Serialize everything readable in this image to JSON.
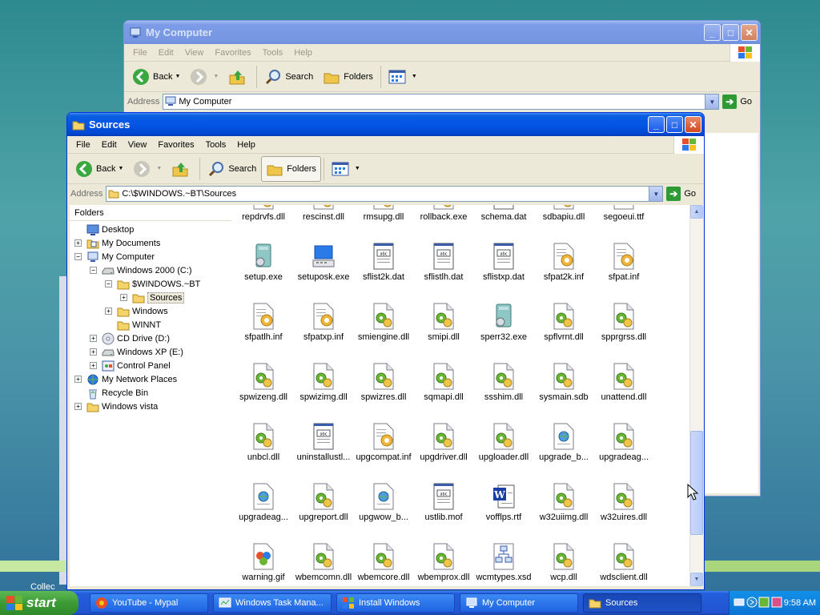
{
  "my_computer_window": {
    "title": "My Computer",
    "menu": [
      "File",
      "Edit",
      "View",
      "Favorites",
      "Tools",
      "Help"
    ],
    "toolbar": {
      "back": "Back",
      "search": "Search",
      "folders": "Folders"
    },
    "address_label": "Address",
    "address_value": "My Computer",
    "go_label": "Go"
  },
  "sources_window": {
    "title": "Sources",
    "menu": [
      "File",
      "Edit",
      "View",
      "Favorites",
      "Tools",
      "Help"
    ],
    "toolbar": {
      "back": "Back",
      "search": "Search",
      "folders": "Folders"
    },
    "address_label": "Address",
    "address_value": "C:\\$WINDOWS.~BT\\Sources",
    "go_label": "Go",
    "folders_pane_title": "Folders",
    "tree": [
      {
        "label": "Desktop",
        "expander": "none"
      },
      {
        "label": "My Documents",
        "expander": "+"
      },
      {
        "label": "My Computer",
        "expander": "-"
      },
      {
        "label": "Windows 2000 (C:)",
        "expander": "-"
      },
      {
        "label": "$WINDOWS.~BT",
        "expander": "-"
      },
      {
        "label": "Sources",
        "expander": "+",
        "selected": true
      },
      {
        "label": "Windows",
        "expander": "+"
      },
      {
        "label": "WINNT",
        "expander": "none"
      },
      {
        "label": "CD Drive (D:)",
        "expander": "+"
      },
      {
        "label": "Windows XP (E:)",
        "expander": "+"
      },
      {
        "label": "Control Panel",
        "expander": "+"
      },
      {
        "label": "My Network Places",
        "expander": "+"
      },
      {
        "label": "Recycle Bin",
        "expander": "none"
      },
      {
        "label": "Windows vista",
        "expander": "+"
      }
    ],
    "files": [
      {
        "name": "repdrvfs.dll",
        "icon": "dll"
      },
      {
        "name": "rescinst.dll",
        "icon": "dll"
      },
      {
        "name": "rmsupg.dll",
        "icon": "dll"
      },
      {
        "name": "rollback.exe",
        "icon": "exe"
      },
      {
        "name": "schema.dat",
        "icon": "dat"
      },
      {
        "name": "sdbapiu.dll",
        "icon": "dll"
      },
      {
        "name": "segoeui.ttf",
        "icon": "ttf"
      },
      {
        "name": "setup.exe",
        "icon": "setup"
      },
      {
        "name": "setuposk.exe",
        "icon": "setuposk"
      },
      {
        "name": "sflist2k.dat",
        "icon": "dat"
      },
      {
        "name": "sflistlh.dat",
        "icon": "dat"
      },
      {
        "name": "sflistxp.dat",
        "icon": "dat"
      },
      {
        "name": "sfpat2k.inf",
        "icon": "inf"
      },
      {
        "name": "sfpat.inf",
        "icon": "inf"
      },
      {
        "name": "sfpatlh.inf",
        "icon": "inf"
      },
      {
        "name": "sfpatxp.inf",
        "icon": "inf"
      },
      {
        "name": "smiengine.dll",
        "icon": "dll"
      },
      {
        "name": "smipi.dll",
        "icon": "dll"
      },
      {
        "name": "sperr32.exe",
        "icon": "setup"
      },
      {
        "name": "spflvrnt.dll",
        "icon": "dll"
      },
      {
        "name": "spprgrss.dll",
        "icon": "dll"
      },
      {
        "name": "spwizeng.dll",
        "icon": "dll"
      },
      {
        "name": "spwizimg.dll",
        "icon": "dll"
      },
      {
        "name": "spwizres.dll",
        "icon": "dll"
      },
      {
        "name": "sqmapi.dll",
        "icon": "dll"
      },
      {
        "name": "ssshim.dll",
        "icon": "dll"
      },
      {
        "name": "sysmain.sdb",
        "icon": "dll"
      },
      {
        "name": "unattend.dll",
        "icon": "dll"
      },
      {
        "name": "unbcl.dll",
        "icon": "dll"
      },
      {
        "name": "uninstallustl...",
        "icon": "dat"
      },
      {
        "name": "upgcompat.inf",
        "icon": "inf"
      },
      {
        "name": "upgdriver.dll",
        "icon": "dll"
      },
      {
        "name": "upgloader.dll",
        "icon": "dll"
      },
      {
        "name": "upgrade_b...",
        "icon": "web"
      },
      {
        "name": "upgradeag...",
        "icon": "dll"
      },
      {
        "name": "upgradeag...",
        "icon": "web"
      },
      {
        "name": "upgreport.dll",
        "icon": "dll"
      },
      {
        "name": "upgwow_b...",
        "icon": "web"
      },
      {
        "name": "ustlib.mof",
        "icon": "dat"
      },
      {
        "name": "vofflps.rtf",
        "icon": "word"
      },
      {
        "name": "w32uiimg.dll",
        "icon": "dll"
      },
      {
        "name": "w32uires.dll",
        "icon": "dll"
      },
      {
        "name": "warning.gif",
        "icon": "gif"
      },
      {
        "name": "wbemcomn.dll",
        "icon": "dll"
      },
      {
        "name": "wbemcore.dll",
        "icon": "dll"
      },
      {
        "name": "wbemprox.dll",
        "icon": "dll"
      },
      {
        "name": "wcmtypes.xsd",
        "icon": "xsd"
      },
      {
        "name": "wcp.dll",
        "icon": "dll"
      },
      {
        "name": "wdsclient.dll",
        "icon": "dll"
      }
    ]
  },
  "background_window_label": "Collec",
  "taskbar": {
    "start_label": "start",
    "tasks": [
      {
        "label": "YouTube - Mypal",
        "icon": "browser"
      },
      {
        "label": "Windows Task Mana...",
        "icon": "taskmgr"
      },
      {
        "label": "Install Windows",
        "icon": "install"
      },
      {
        "label": "My Computer",
        "icon": "computer"
      },
      {
        "label": "Sources",
        "icon": "folder",
        "active": true
      }
    ],
    "clock": "9:58 AM"
  },
  "colors": {
    "titlebar_active": "#0454e6",
    "taskbar": "#245edc",
    "start": "#3c9b35",
    "tray": "#0c74d6"
  }
}
